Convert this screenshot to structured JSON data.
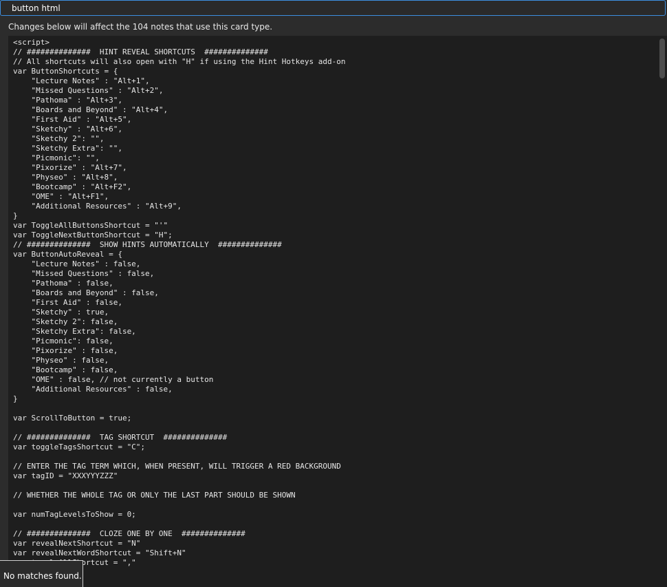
{
  "search": {
    "value": "button html"
  },
  "info_label": "Changes below will affect the 104 notes that use this card type.",
  "popup": {
    "message": "No matches found."
  },
  "code_lines": [
    "<script>",
    "// ##############  HINT REVEAL SHORTCUTS  ##############",
    "// All shortcuts will also open with \"H\" if using the Hint Hotkeys add-on",
    "var ButtonShortcuts = {",
    "    \"Lecture Notes\" : \"Alt+1\",",
    "    \"Missed Questions\" : \"Alt+2\",",
    "    \"Pathoma\" : \"Alt+3\",",
    "    \"Boards and Beyond\" : \"Alt+4\",",
    "    \"First Aid\" : \"Alt+5\",",
    "    \"Sketchy\" : \"Alt+6\",",
    "    \"Sketchy 2\": \"\",",
    "    \"Sketchy Extra\": \"\",",
    "    \"Picmonic\": \"\",",
    "    \"Pixorize\" : \"Alt+7\",",
    "    \"Physeo\" : \"Alt+8\",",
    "    \"Bootcamp\" : \"Alt+F2\",",
    "    \"OME\" : \"Alt+F1\",",
    "    \"Additional Resources\" : \"Alt+9\",",
    "}",
    "var ToggleAllButtonsShortcut = \"'\"",
    "var ToggleNextButtonShortcut = \"H\";",
    "// ##############  SHOW HINTS AUTOMATICALLY  ##############",
    "var ButtonAutoReveal = {",
    "    \"Lecture Notes\" : false,",
    "    \"Missed Questions\" : false,",
    "    \"Pathoma\" : false,",
    "    \"Boards and Beyond\" : false,",
    "    \"First Aid\" : false,",
    "    \"Sketchy\" : true,",
    "    \"Sketchy 2\": false,",
    "    \"Sketchy Extra\": false,",
    "    \"Picmonic\": false,",
    "    \"Pixorize\" : false,",
    "    \"Physeo\" : false,",
    "    \"Bootcamp\" : false,",
    "    \"OME\" : false, // not currently a button",
    "    \"Additional Resources\" : false,",
    "}",
    "",
    "var ScrollToButton = true;",
    "",
    "// ##############  TAG SHORTCUT  ##############",
    "var toggleTagsShortcut = \"C\";",
    "",
    "// ENTER THE TAG TERM WHICH, WHEN PRESENT, WILL TRIGGER A RED BACKGROUND",
    "var tagID = \"XXXYYYZZZ\"",
    "",
    "// WHETHER THE WHOLE TAG OR ONLY THE LAST PART SHOULD BE SHOWN",
    "",
    "var numTagLevelsToShow = 0;",
    "",
    "// ##############  CLOZE ONE BY ONE  ##############",
    "var revealNextShortcut = \"N\"",
    "var revealNextWordShortcut = \"Shift+N\"",
    "var toggleAllShortcut = \",\"",
    ""
  ]
}
